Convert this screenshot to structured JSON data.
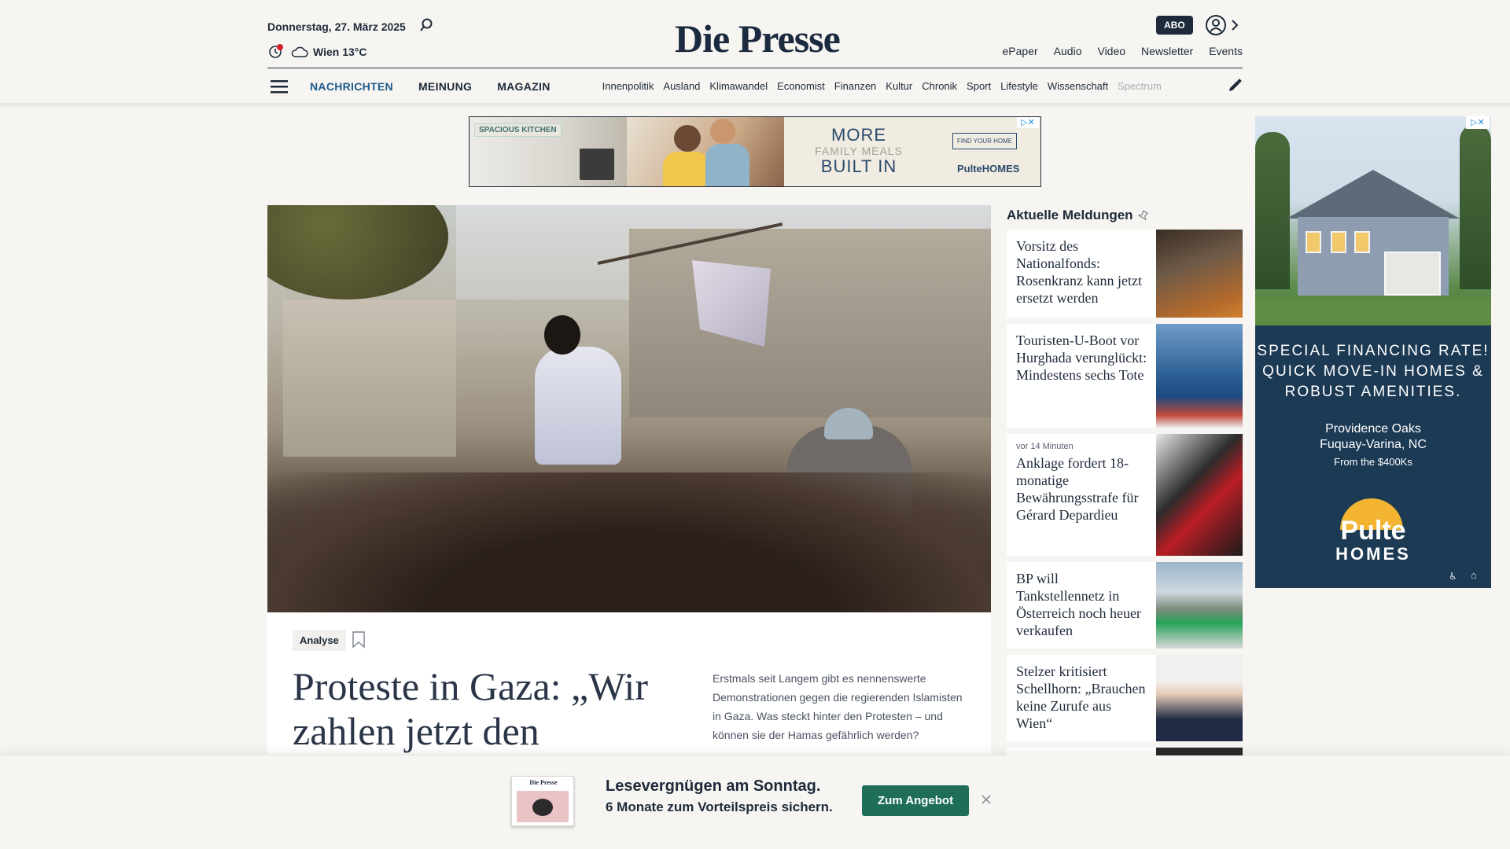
{
  "header": {
    "date": "Donnerstag, 27. März 2025",
    "weather": "Wien 13°C",
    "logo": "Die Presse",
    "abo_label": "ABO",
    "top_links": [
      "ePaper",
      "Audio",
      "Video",
      "Newsletter",
      "Events"
    ]
  },
  "nav": {
    "main": [
      {
        "label": "NACHRICHTEN",
        "active": true
      },
      {
        "label": "MEINUNG",
        "active": false
      },
      {
        "label": "MAGAZIN",
        "active": false
      }
    ],
    "sub": [
      "Innenpolitik",
      "Ausland",
      "Klimawandel",
      "Economist",
      "Finanzen",
      "Kultur",
      "Chronik",
      "Sport",
      "Lifestyle",
      "Wissenschaft",
      "Spectrum"
    ]
  },
  "top_ad": {
    "badge": "SPACIOUS KITCHEN",
    "line1": "MORE",
    "line2": "FAMILY MEALS",
    "line3": "BUILT IN",
    "cta": "FIND YOUR HOME",
    "brand": "PulteHOMES"
  },
  "side_ad": {
    "headline": "SPECIAL FINANCING RATE! QUICK MOVE-IN HOMES & ROBUST AMENITIES.",
    "community": "Providence Oaks",
    "location": "Fuquay-Varina, NC",
    "price": "From the $400Ks",
    "brand": "Pulte",
    "brand_sub": "HOMES"
  },
  "lead": {
    "badge": "Analyse",
    "title": "Proteste in Gaza: „Wir zahlen jetzt den",
    "teaser": "Erstmals seit Langem gibt es nennenswerte Demonstrationen gegen die regierenden Islamisten in Gaza. Was steckt hinter den Protesten – und können sie der Hamas gefährlich werden?"
  },
  "news": {
    "title": "Aktuelle Meldungen",
    "items": [
      {
        "meta": "",
        "headline": "Vorsitz des Nationalfonds: Rosenkranz kann jetzt ersetzt werden"
      },
      {
        "meta": "",
        "headline": "Touristen-U-Boot vor Hurghada verunglückt: Mindestens sechs Tote"
      },
      {
        "meta": "vor 14 Minuten",
        "headline": "Anklage fordert 18-monatige Bewährungsstrafe für Gérard Depardieu"
      },
      {
        "meta": "",
        "headline": "BP will Tankstellennetz in Österreich noch heuer verkaufen"
      },
      {
        "meta": "",
        "headline": "Stelzer kritisiert Schellhorn: „Brauchen keine Zurufe aus Wien“"
      }
    ]
  },
  "promo": {
    "thumb_title": "Die Presse",
    "line1": "Lesevergnügen am Sonntag.",
    "line2": "6 Monate zum Vorteilspreis sichern.",
    "button": "Zum Angebot"
  }
}
